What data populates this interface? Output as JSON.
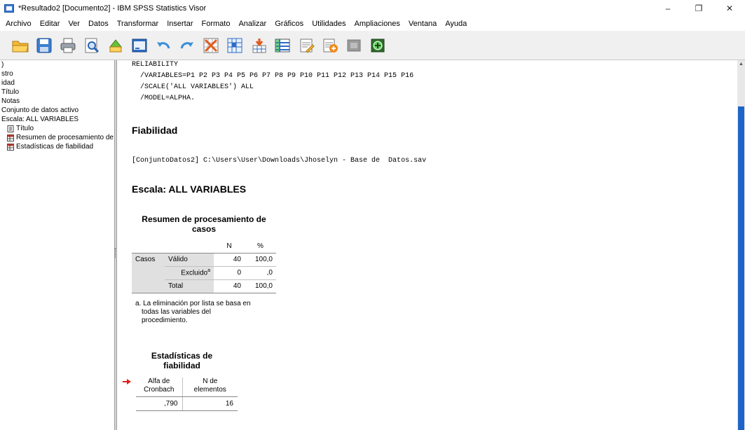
{
  "window": {
    "title": "*Resultado2 [Documento2] - IBM SPSS Statistics Visor",
    "controls": [
      "–",
      "❐",
      "✕"
    ]
  },
  "menu": [
    "Archivo",
    "Editar",
    "Ver",
    "Datos",
    "Transformar",
    "Insertar",
    "Formato",
    "Analizar",
    "Gráficos",
    "Utilidades",
    "Ampliaciones",
    "Ventana",
    "Ayuda"
  ],
  "outline": {
    "items": [
      ")",
      "stro",
      "idad",
      "Título",
      "Notas",
      "Conjunto de datos activo",
      "Escala: ALL VARIABLES",
      "Título",
      "Resumen de procesamiento de",
      "Estadísticas de fiabilidad"
    ]
  },
  "content": {
    "syntax": [
      "RELIABILITY",
      "  /VARIABLES=P1 P2 P3 P4 P5 P6 P7 P8 P9 P10 P11 P12 P13 P14 P15 P16",
      "  /SCALE('ALL VARIABLES') ALL",
      "  /MODEL=ALPHA."
    ],
    "heading_fiabilidad": "Fiabilidad",
    "dataset": "[ConjuntoDatos2] C:\\Users\\User\\Downloads\\Jhoselyn - Base de  Datos.sav",
    "heading_escala": "Escala: ALL VARIABLES",
    "table1": {
      "title_line1": "Resumen de procesamiento de",
      "title_line2": "casos",
      "col_n": "N",
      "col_pct": "%",
      "row_group": "Casos",
      "rows": [
        {
          "label": "Válido",
          "n": "40",
          "pct": "100,0"
        },
        {
          "label": "Excluido",
          "sup": "a",
          "n": "0",
          "pct": ",0"
        },
        {
          "label": "Total",
          "n": "40",
          "pct": "100,0"
        }
      ],
      "footnote": [
        "a. La eliminación por lista se basa en",
        "todas las variables del",
        "procedimiento."
      ]
    },
    "table2": {
      "title_line1": "Estadísticas de",
      "title_line2": "fiabilidad",
      "col1_line1": "Alfa de",
      "col1_line2": "Cronbach",
      "col2_line1": "N de",
      "col2_line2": "elementos",
      "alpha": ",790",
      "n_items": "16"
    }
  },
  "colors": {
    "scroll_thumb": "#1e64c8",
    "toolbar_bg": "#f0f0f0",
    "marker_arrow": "#e02020"
  }
}
